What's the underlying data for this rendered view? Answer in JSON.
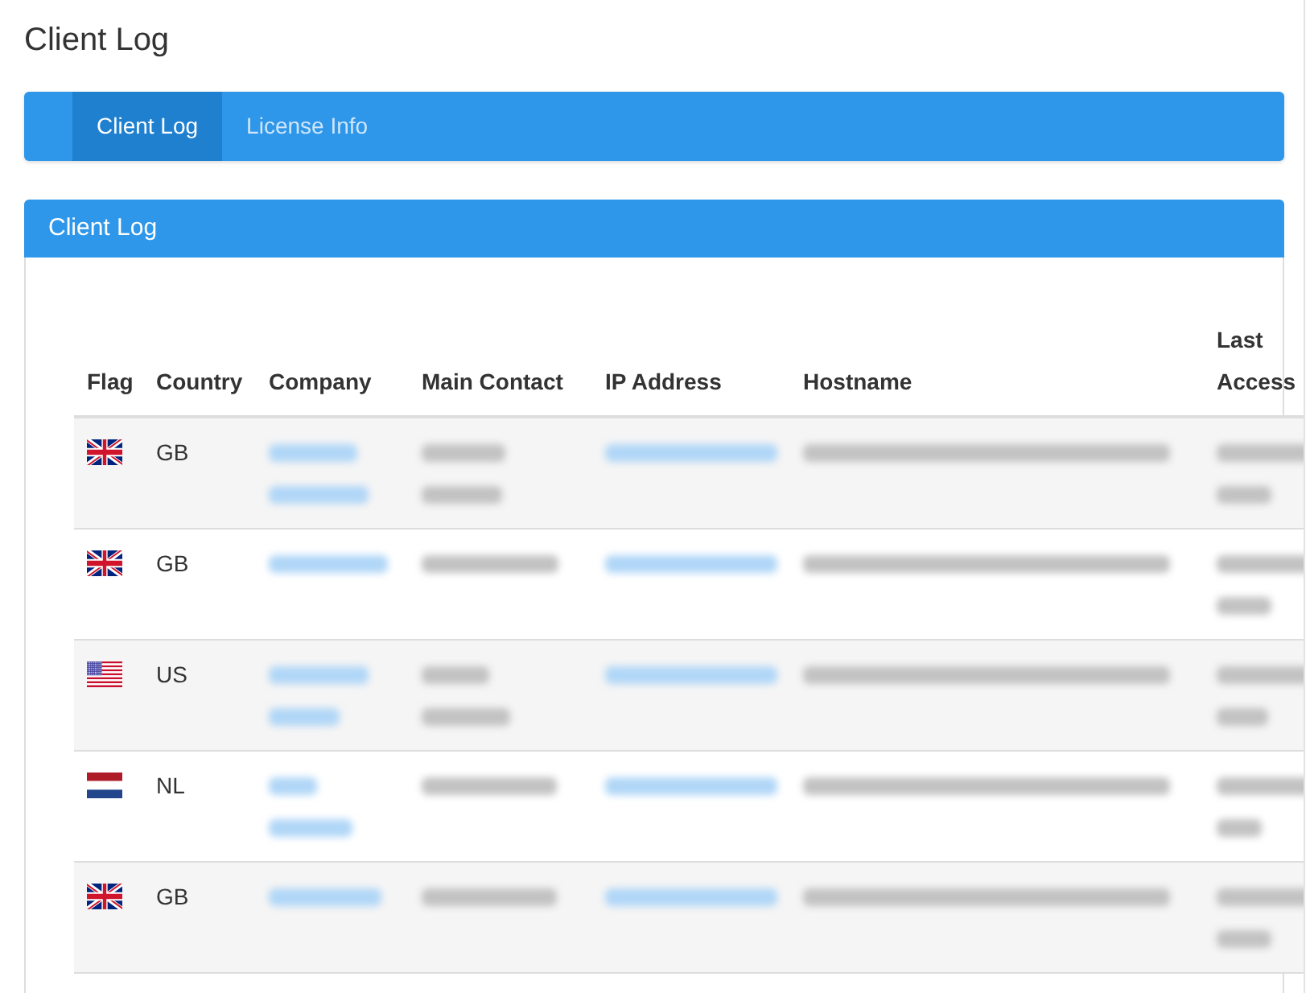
{
  "page_title": "Client Log",
  "tabs": [
    {
      "label": "Client Log",
      "selected": true
    },
    {
      "label": "License Info",
      "selected": false
    }
  ],
  "panel": {
    "title": "Client Log",
    "table": {
      "columns": [
        "Flag",
        "Country",
        "Company",
        "Main Contact",
        "IP Address",
        "Hostname",
        "Last Access"
      ],
      "rows": [
        {
          "flag": {
            "kind": "uk"
          },
          "country": "GB"
        },
        {
          "flag": {
            "kind": "uk"
          },
          "country": "GB"
        },
        {
          "flag": {
            "kind": "us"
          },
          "country": "US"
        },
        {
          "flag": {
            "kind": "nl"
          },
          "country": "NL"
        },
        {
          "flag": {
            "kind": "uk"
          },
          "country": "GB"
        }
      ]
    }
  }
}
